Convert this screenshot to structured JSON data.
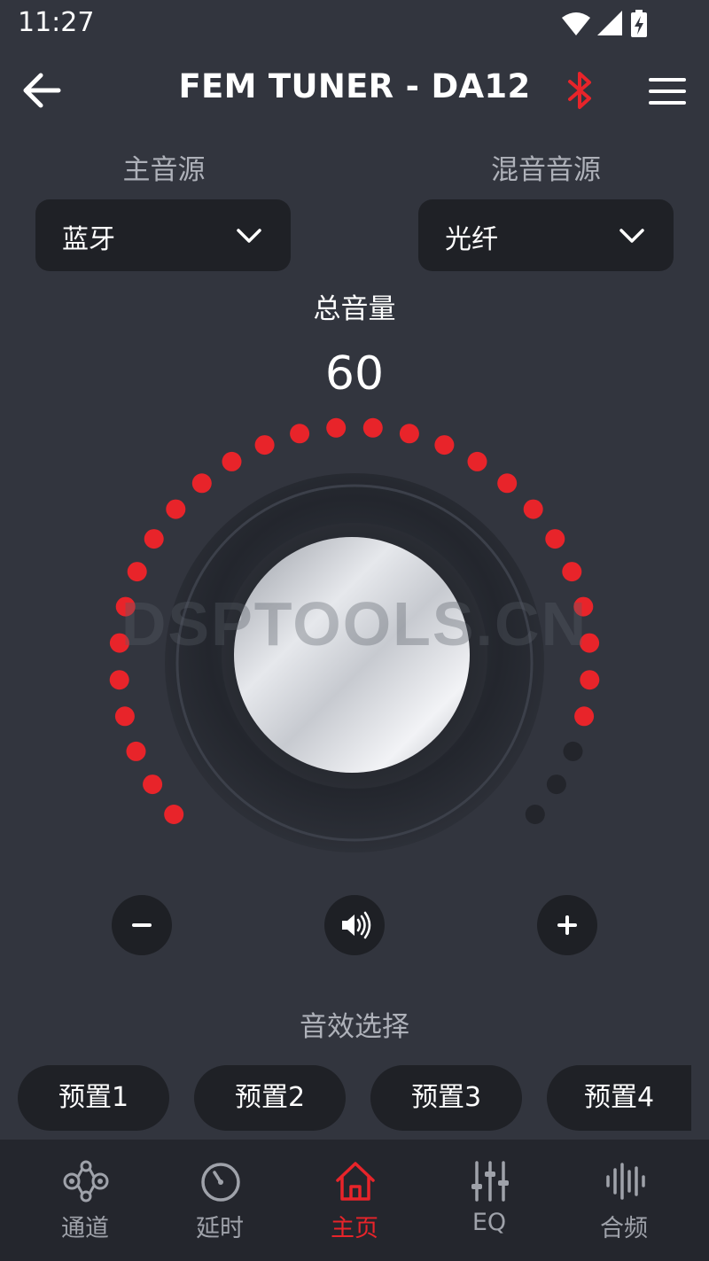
{
  "status_bar": {
    "time": "11:27",
    "icons": [
      "wifi-icon",
      "cell-signal-icon",
      "battery-charging-icon"
    ]
  },
  "header": {
    "title": "FEM TUNER - DA12",
    "back_icon": "arrow-left-icon",
    "bluetooth_icon": "bluetooth-icon",
    "menu_icon": "hamburger-menu-icon"
  },
  "sources": {
    "main": {
      "label": "主音源",
      "value": "蓝牙"
    },
    "mix": {
      "label": "混音音源",
      "value": "光纤"
    }
  },
  "volume": {
    "label": "总音量",
    "value": "60",
    "level": 60,
    "max": 66
  },
  "controls": {
    "minus_icon": "minus-icon",
    "speaker_icon": "speaker-volume-icon",
    "plus_icon": "plus-icon"
  },
  "effects": {
    "label": "音效选择",
    "presets": [
      "预置1",
      "预置2",
      "预置3",
      "预置4"
    ]
  },
  "nav": {
    "active": 2,
    "items": [
      {
        "label": "通道",
        "icon": "channel-nodes-icon"
      },
      {
        "label": "延时",
        "icon": "timer-dial-icon"
      },
      {
        "label": "主页",
        "icon": "home-icon"
      },
      {
        "label": "EQ",
        "icon": "eq-sliders-icon"
      },
      {
        "label": "合频",
        "icon": "waveform-icon"
      }
    ]
  },
  "colors": {
    "background": "#32353e",
    "accent": "#e8242a",
    "panel": "#1f2126",
    "inactive_dot": "#23252b"
  }
}
